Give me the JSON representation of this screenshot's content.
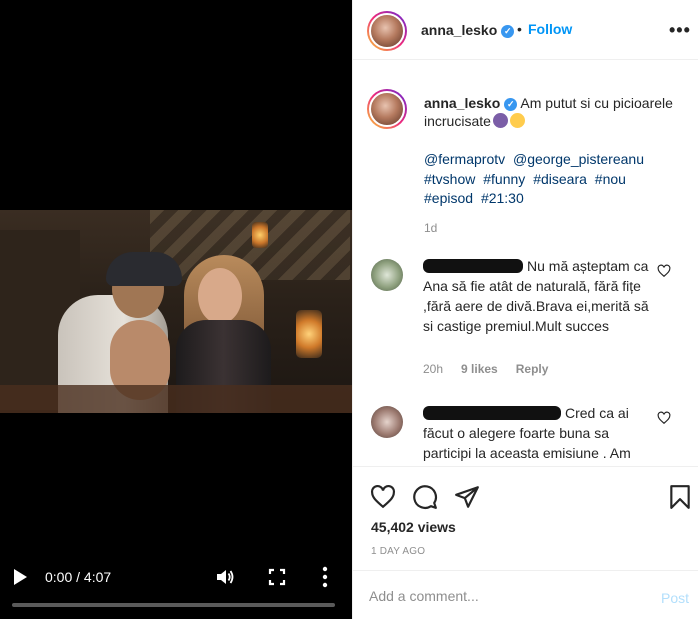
{
  "video": {
    "time": "0:00 / 4:07",
    "progress_percent": 0
  },
  "header": {
    "username": "anna_lesko",
    "dot": "•",
    "follow_label": "Follow",
    "more_label": "•••"
  },
  "caption": {
    "username": "anna_lesko",
    "text": "Am putut si cu picioarele incrucisate",
    "tags": [
      "@fermaprotv",
      "@george_pistereanu",
      "#tvshow",
      "#funny",
      "#diseara",
      "#nou",
      "#episod",
      "#21:30"
    ],
    "time": "1d"
  },
  "comments": [
    {
      "text": "Nu mă așteptam ca Ana să fie atât de naturală, fără fițe ,fără aere de divă.Brava ei,merită să si castige premiul.Mult succes",
      "time": "20h",
      "likes": "9 likes",
      "reply_label": "Reply"
    },
    {
      "text": "Cred ca ai făcut o alegere foarte buna sa participi la aceasta emisiune . Am"
    }
  ],
  "stats": {
    "views": "45,402 views",
    "posted": "1 DAY AGO"
  },
  "add_comment": {
    "placeholder": "Add a comment...",
    "post_label": "Post"
  },
  "colors": {
    "accent": "#0095f6",
    "verified": "#3897f0",
    "muted": "#8e8e8e",
    "tag": "#00376b"
  }
}
